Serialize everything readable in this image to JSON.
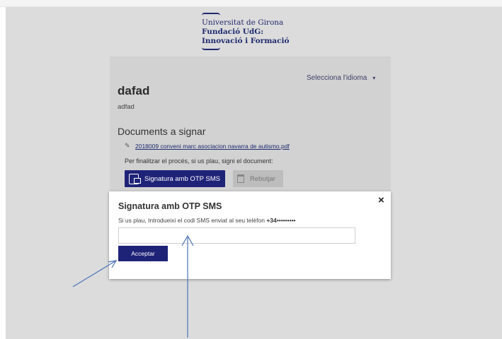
{
  "logo": {
    "line1": "Universitat de Girona",
    "line2": "Fundació UdG:",
    "line3": "Innovació i Formació"
  },
  "language": {
    "label": "Selecciona l'idioma",
    "caret": "▾"
  },
  "document": {
    "title": "dafad",
    "subtitle": "adfad",
    "section_heading": "Documents a signar",
    "file_name": "2018009 conveni marc asociacion navarra de autismo.pdf",
    "instructions": "Per finalitzar el procés, si us plau, signi el document:"
  },
  "actions": {
    "sign_label": "Signatura amb OTP SMS",
    "reject_label": "Rebutjar"
  },
  "modal": {
    "title": "Signatura amb OTP SMS",
    "close": "×",
    "text": "Si us plau, Introdueixi el codi SMS enviat al seu telèfon",
    "phone": "+34•••••••••",
    "input_value": "",
    "input_placeholder": "",
    "accept_label": "Acceptar"
  },
  "colors": {
    "brand": "#1f2378",
    "annotation_arrow": "#4a72b8"
  }
}
